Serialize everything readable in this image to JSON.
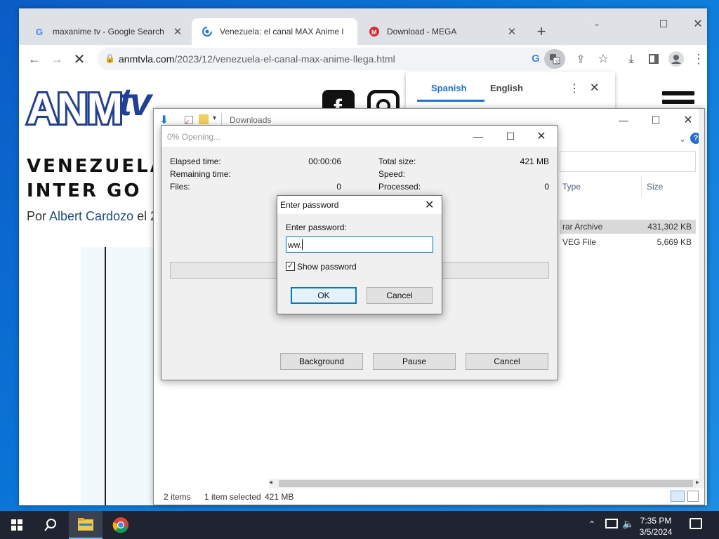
{
  "browser": {
    "tabs": [
      {
        "title": "maxanime tv - Google Search",
        "favicon": "google-icon"
      },
      {
        "title": "Venezuela: el canal MAX Anime l",
        "favicon": "loading-icon"
      },
      {
        "title": "Download - MEGA",
        "favicon": "mega-icon"
      }
    ],
    "url_domain": "anmtvla.com",
    "url_path": "/2023/12/venezuela-el-canal-max-anime-llega.html"
  },
  "translate": {
    "lang_source": "Spanish",
    "lang_target": "English"
  },
  "page": {
    "logo": "ANM",
    "logo_tv": "tv",
    "headline_line1": "VENEZUELA:",
    "headline_line2": "INTER GO",
    "byline_prefix": "Por ",
    "author": "Albert Cardozo",
    "byline_suffix": " el 2"
  },
  "explorer": {
    "title": "Downloads",
    "columns": {
      "type": "Type",
      "size": "Size"
    },
    "files": [
      {
        "type": "rar Archive",
        "size": "431,302 KB"
      },
      {
        "type": "VEG File",
        "size": "5,669 KB"
      }
    ],
    "status_items": "2 items",
    "status_selected": "1 item selected",
    "status_size": "421 MB"
  },
  "progress": {
    "title": "0% Opening...",
    "elapsed_label": "Elapsed time:",
    "elapsed_value": "00:00:06",
    "remaining_label": "Remaining time:",
    "files_label": "Files:",
    "files_value": "0",
    "total_label": "Total size:",
    "total_value": "421 MB",
    "speed_label": "Speed:",
    "processed_label": "Processed:",
    "processed_value": "0",
    "background_label": "Background",
    "pause_label": "Pause",
    "cancel_label": "Cancel"
  },
  "password_dialog": {
    "title": "Enter password",
    "prompt": "Enter password:",
    "value": "ww.",
    "show_password": "Show password",
    "ok": "OK",
    "cancel": "Cancel"
  },
  "taskbar": {
    "time": "7:35 PM",
    "date": "3/5/2024"
  }
}
